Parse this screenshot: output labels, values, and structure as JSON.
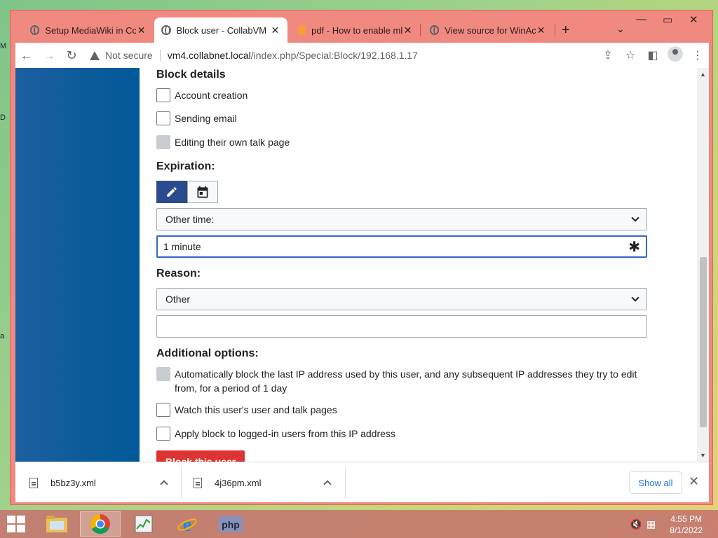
{
  "tabs": [
    {
      "title": "Setup MediaWiki in Coll",
      "icon": "globe-icon",
      "active": false
    },
    {
      "title": "Block user - CollabVM",
      "icon": "globe-icon",
      "active": true
    },
    {
      "title": "pdf - How to enable ml",
      "icon": "pdf-icon",
      "active": false
    },
    {
      "title": "View source for WinAc",
      "icon": "globe-icon",
      "active": false
    }
  ],
  "toolbar": {
    "security_label": "Not secure",
    "url_host": "vm4.collabnet.local",
    "url_path": "/index.php/Special:Block/192.168.1.17"
  },
  "form": {
    "block_details_title": "Block details",
    "block_options": [
      {
        "label": "Account creation",
        "checked": false,
        "disabled": false
      },
      {
        "label": "Sending email",
        "checked": false,
        "disabled": false
      },
      {
        "label": "Editing their own talk page",
        "checked": false,
        "disabled": true
      }
    ],
    "expiration_title": "Expiration:",
    "expiry_select": "Other time:",
    "expiry_value": "1 minute",
    "reason_title": "Reason:",
    "reason_select": "Other",
    "reason_value": "",
    "additional_title": "Additional options:",
    "additional_options": [
      {
        "label": "Automatically block the last IP address used by this user, and any subsequent IP addresses they try to edit from, for a period of 1 day",
        "checked": false,
        "disabled": true
      },
      {
        "label": "Watch this user's user and talk pages",
        "checked": false,
        "disabled": false
      },
      {
        "label": "Apply block to logged-in users from this IP address",
        "checked": false,
        "disabled": false
      }
    ],
    "submit_label": "Block this user"
  },
  "downloads": {
    "items": [
      {
        "filename": "b5bz3y.xml"
      },
      {
        "filename": "4j36pm.xml"
      }
    ],
    "show_all_label": "Show all"
  },
  "taskbar": {
    "time": "4:55 PM",
    "date": "8/1/2022",
    "apps": [
      "file-explorer",
      "chrome",
      "task-manager",
      "internet-explorer",
      "php"
    ]
  },
  "colors": {
    "window_frame": "#f08a80",
    "accent_blue": "#2a4b8d",
    "destructive": "#dd3333",
    "link": "#1a73e8"
  }
}
